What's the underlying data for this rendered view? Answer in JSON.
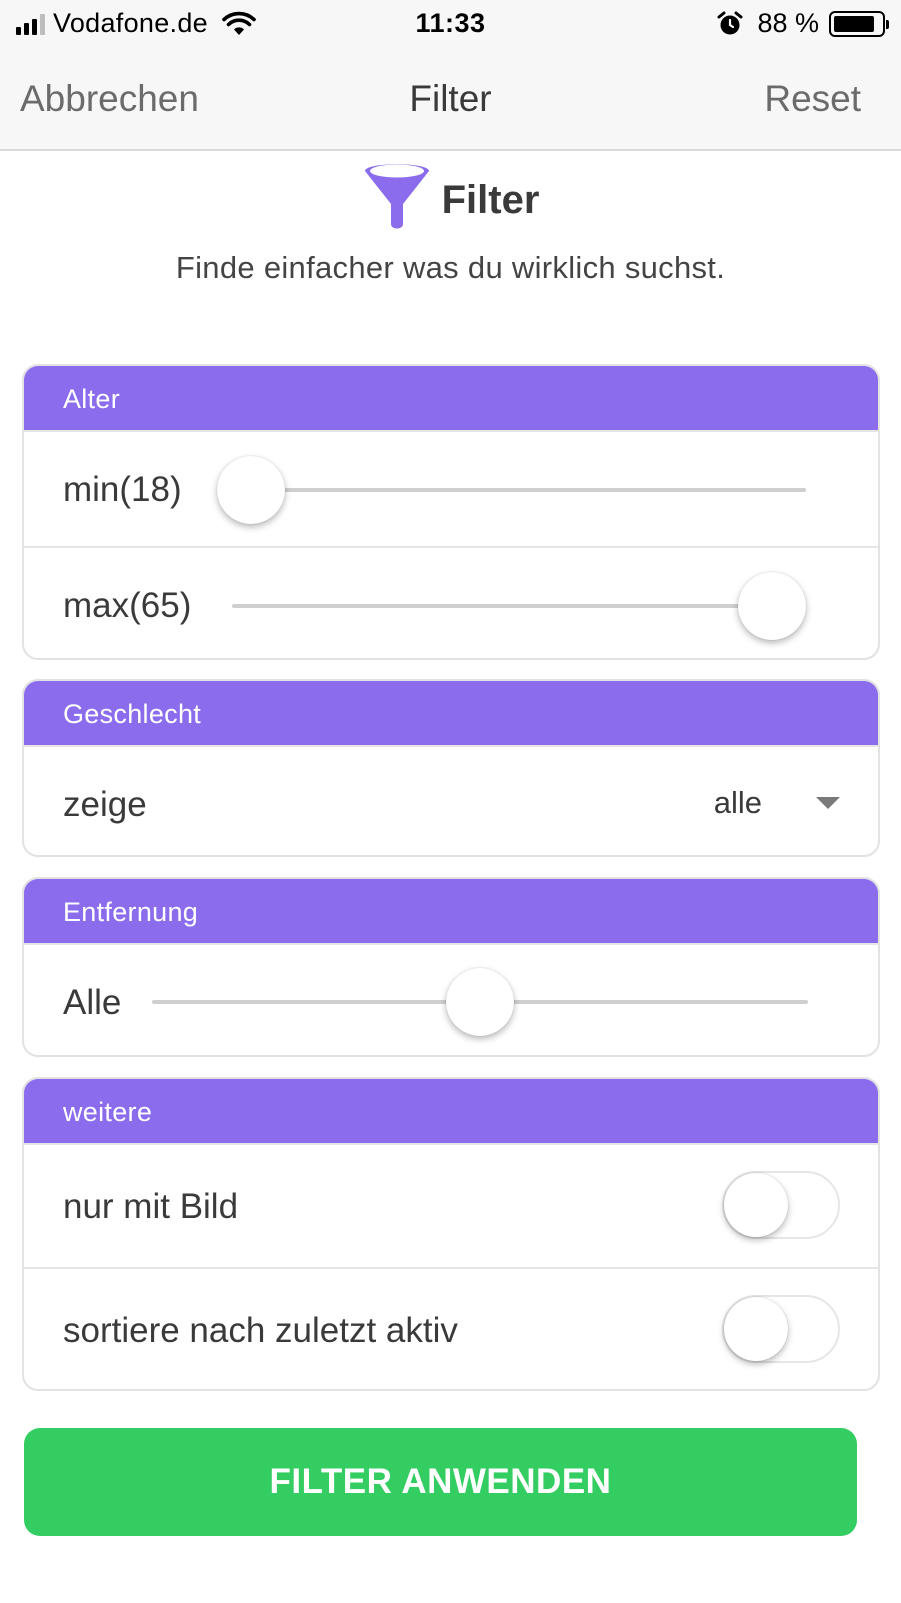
{
  "status_bar": {
    "carrier": "Vodafone.de",
    "time": "11:33",
    "battery_percent": "88 %",
    "battery_level": 0.88,
    "icons": [
      "signal-icon",
      "wifi-icon",
      "alarm-icon",
      "battery-icon"
    ]
  },
  "nav": {
    "cancel_label": "Abbrechen",
    "title": "Filter",
    "reset_label": "Reset"
  },
  "hero": {
    "icon": "funnel-icon",
    "title": "Filter",
    "subtitle": "Finde einfacher was du wirklich suchst."
  },
  "sections": {
    "age": {
      "header": "Alter",
      "min_label": "min(18)",
      "min_value": 18,
      "max_label": "max(65)",
      "max_value": 65
    },
    "gender": {
      "header": "Geschlecht",
      "label": "zeige",
      "selected": "alle"
    },
    "distance": {
      "header": "Entfernung",
      "label": "Alle",
      "slider_fraction": 0.5
    },
    "more": {
      "header": "weitere",
      "only_with_photo": {
        "label": "nur mit Bild",
        "on": false
      },
      "sort_last_active": {
        "label": "sortiere nach zuletzt aktiv",
        "on": false
      }
    }
  },
  "apply_button": "FILTER ANWENDEN",
  "colors": {
    "accent": "#8a6ced",
    "apply": "#34cd62",
    "nav_bg": "#f7f7f7"
  }
}
